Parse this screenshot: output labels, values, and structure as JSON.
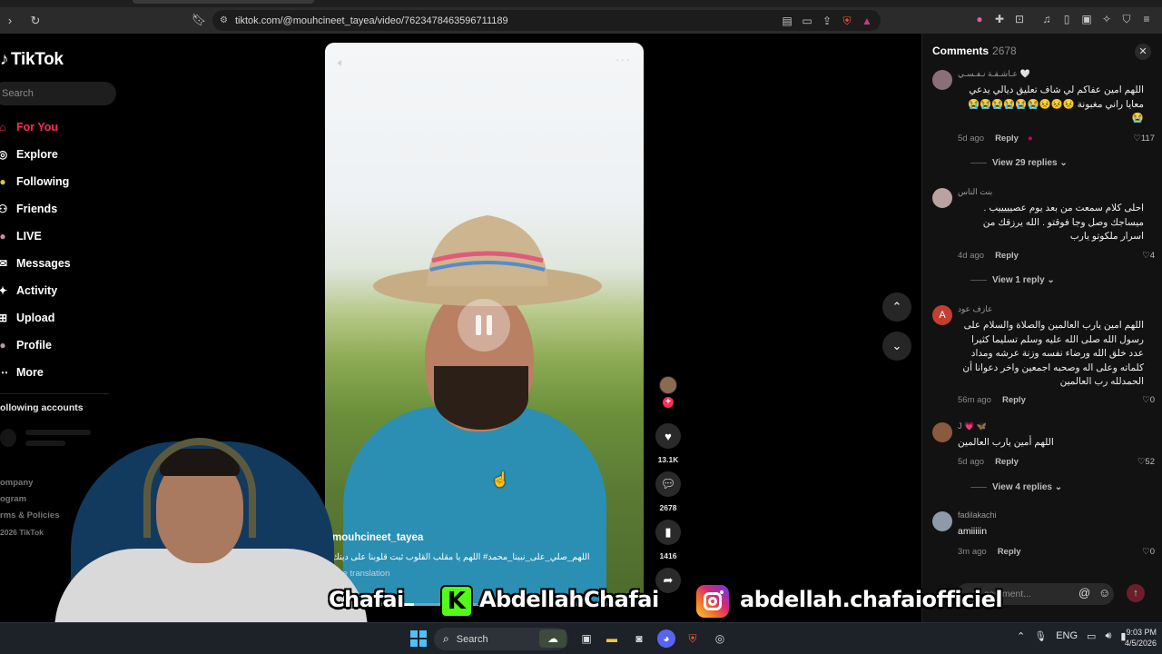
{
  "browser": {
    "url": "tiktok.com/@mouhcineet_tayea/video/7623478463596711189"
  },
  "sidebar": {
    "logo": "TikTok",
    "search_placeholder": "Search",
    "items": [
      {
        "label": "For You",
        "icon": "home-icon"
      },
      {
        "label": "Explore",
        "icon": "compass-icon"
      },
      {
        "label": "Following",
        "icon": "following-icon"
      },
      {
        "label": "Friends",
        "icon": "friends-icon"
      },
      {
        "label": "LIVE",
        "icon": "live-icon"
      },
      {
        "label": "Messages",
        "icon": "messages-icon"
      },
      {
        "label": "Activity",
        "icon": "activity-icon"
      },
      {
        "label": "Upload",
        "icon": "upload-icon"
      },
      {
        "label": "Profile",
        "icon": "profile-icon"
      },
      {
        "label": "More",
        "icon": "more-icon"
      }
    ],
    "following_header": "ollowing accounts",
    "footer": [
      "ompany",
      "ogram",
      "rms & Policies",
      "2026 TikTok"
    ]
  },
  "video": {
    "author": "mouhcineet_tayea",
    "caption": "اللهم_صلي_على_نبينا_محمد# اللهم يا مقلب القلوب ثبت قلوبنا على دينك",
    "see_translation": "See translation",
    "progress": 0.28
  },
  "actions": {
    "likes": "13.1K",
    "comments": "2678",
    "saves": "1416"
  },
  "comments_panel": {
    "title": "Comments",
    "count": "2678",
    "input_placeholder": "comment...",
    "items": [
      {
        "name": "عـاشـقـة نـفـسـي 🤍",
        "text": "اللهم امين عفاكم لي شاف تعليق ديالي يدعي معايا راني مغبونة 😣😣😣😭😭😭😭😭😭😭",
        "time": "5d ago",
        "reply": "Reply",
        "likes": "117",
        "view": "View 29 replies"
      },
      {
        "name": "بنت الناس",
        "text": "احلى كلام سمعت من بعد يوم عصيييييب . ميساجك وصل وجا فوقتو . الله يرزقك من اسرار ملكوتو يارب",
        "time": "4d ago",
        "reply": "Reply",
        "likes": "4",
        "view": "View 1 reply"
      },
      {
        "name": "عازف عود",
        "initial": "A",
        "text": "اللهم امين يارب العالمين والصلاة والسلام على رسول الله صلى الله عليه وسلم تسليما كثيرا عدد خلق الله ورضاء نفسه وزنة عرشه ومداد كلماته وعلى اله وصحبه اجمعين واخر دعوانا أن الحمدلله رب العالمين",
        "time": "56m ago",
        "reply": "Reply",
        "likes": "0"
      },
      {
        "name": "J 💗 🦋",
        "text": "اللهم أمين يارب العالمين",
        "time": "5d ago",
        "reply": "Reply",
        "likes": "52",
        "view": "View 4 replies"
      },
      {
        "name": "fadilakachi",
        "text": "amiiiiin",
        "time": "3m ago",
        "reply": "Reply",
        "likes": "0"
      }
    ]
  },
  "overlay": {
    "left_text": "Chafai",
    "kick_handle": "AbdellahChafai",
    "insta_handle": "abdellah.chafaiofficiel"
  },
  "taskbar": {
    "search": "Search",
    "lang": "ENG",
    "time": "9:03 PM",
    "date": "4/5/2026"
  }
}
